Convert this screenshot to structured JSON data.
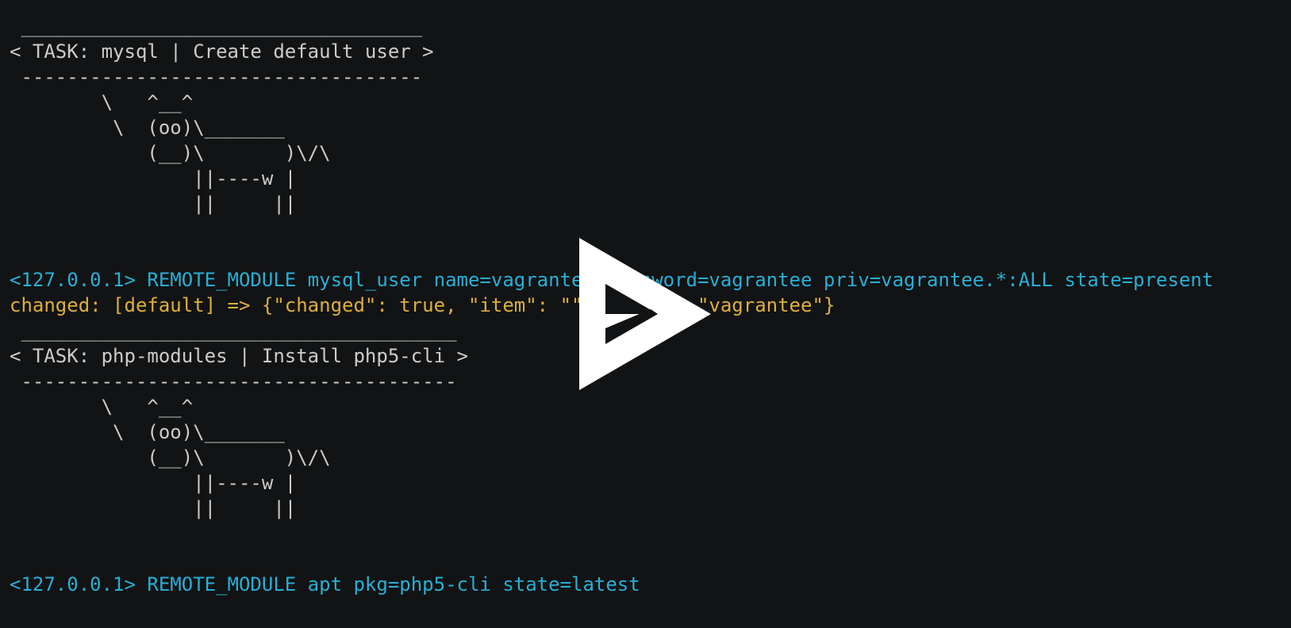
{
  "terminal": {
    "colors": {
      "background": "#121314",
      "default": "#cccccc",
      "cyan": "#26b0d7",
      "yellow": "#ddaf3c"
    },
    "lines": [
      {
        "text": " ___________________________________",
        "color": "default"
      },
      {
        "text": "< TASK: mysql | Create default user >",
        "color": "default"
      },
      {
        "text": " -----------------------------------",
        "color": "default"
      },
      {
        "text": "        \\   ^__^",
        "color": "default"
      },
      {
        "text": "         \\  (oo)\\_______",
        "color": "default"
      },
      {
        "text": "            (__)\\       )\\/\\",
        "color": "default"
      },
      {
        "text": "                ||----w |",
        "color": "default"
      },
      {
        "text": "                ||     ||",
        "color": "default"
      },
      {
        "text": "",
        "color": "default"
      },
      {
        "text": "",
        "color": "default"
      },
      {
        "text": "<127.0.0.1> REMOTE_MODULE mysql_user name=vagrantee password=vagrantee priv=vagrantee.*:ALL state=present",
        "color": "cyan"
      },
      {
        "text": "changed: [default] => {\"changed\": true, \"item\": \"\", \"user\": \"vagrantee\"}",
        "color": "yellow"
      },
      {
        "text": " ______________________________________",
        "color": "default"
      },
      {
        "text": "< TASK: php-modules | Install php5-cli >",
        "color": "default"
      },
      {
        "text": " --------------------------------------",
        "color": "default"
      },
      {
        "text": "        \\   ^__^",
        "color": "default"
      },
      {
        "text": "         \\  (oo)\\_______",
        "color": "default"
      },
      {
        "text": "            (__)\\       )\\/\\",
        "color": "default"
      },
      {
        "text": "                ||----w |",
        "color": "default"
      },
      {
        "text": "                ||     ||",
        "color": "default"
      },
      {
        "text": "",
        "color": "default"
      },
      {
        "text": "",
        "color": "default"
      },
      {
        "text": "<127.0.0.1> REMOTE_MODULE apt pkg=php5-cli state=latest",
        "color": "cyan"
      }
    ]
  },
  "overlay": {
    "icon": "asciinema-play-icon"
  }
}
